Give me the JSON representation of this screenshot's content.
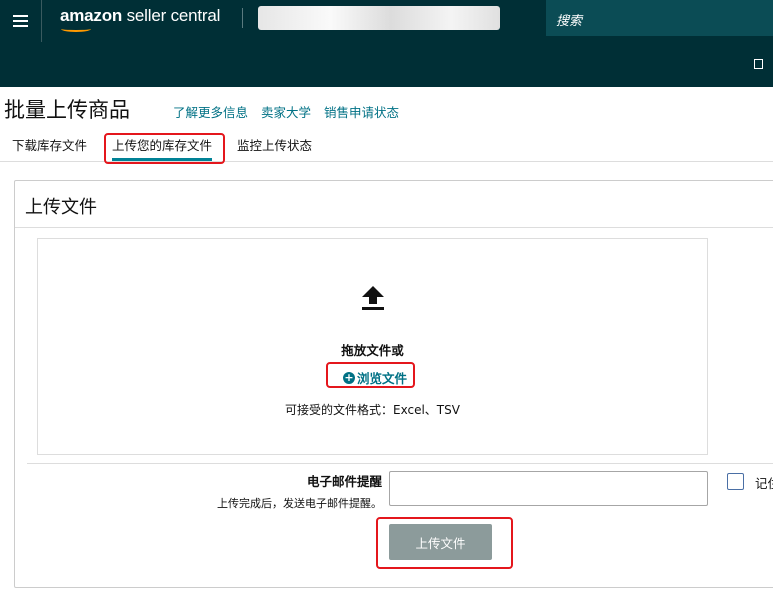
{
  "header": {
    "logo_text_bold": "amazon",
    "logo_text_rest": " seller central",
    "search_placeholder": "搜索"
  },
  "page": {
    "title": "批量上传商品",
    "links": [
      "了解更多信息",
      "卖家大学",
      "销售申请状态"
    ]
  },
  "tabs": [
    {
      "label": "下载库存文件"
    },
    {
      "label": "上传您的库存文件",
      "active": true
    },
    {
      "label": "监控上传状态"
    }
  ],
  "panel": {
    "title": "上传文件",
    "dropzone": {
      "drag_text": "拖放文件或",
      "browse_label": "浏览文件",
      "formats": "可接受的文件格式：Excel、TSV"
    },
    "email": {
      "label": "电子邮件提醒",
      "hint": "上传完成后，发送电子邮件提醒。",
      "value": ""
    },
    "remember_label": "记住",
    "upload_button": "上传文件"
  },
  "icons": {
    "menu": "hamburger-icon",
    "upload": "upload-arrow-icon",
    "browse": "plus-circle-icon",
    "bookmark": "bookmark-icon"
  },
  "colors": {
    "header_bg": "#002f36",
    "link": "#007185",
    "tab_underline": "#008296",
    "highlight_box": "#e4161c",
    "button_bg": "#8c9b9b"
  }
}
